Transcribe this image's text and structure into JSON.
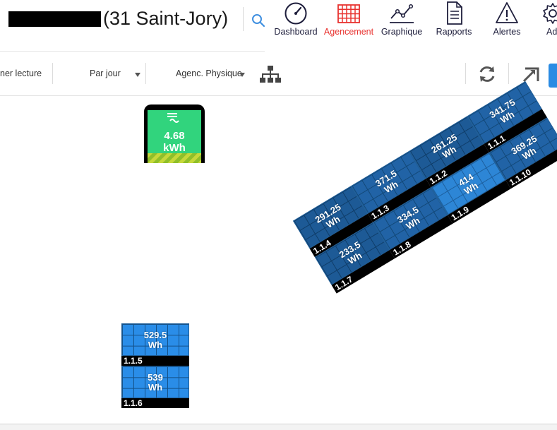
{
  "header": {
    "site_name": "(31 Saint-Jory)",
    "nav": [
      {
        "label": "Dashboard",
        "icon": "dashboard-gauge-icon",
        "active": false
      },
      {
        "label": "Agencement",
        "icon": "grid-icon",
        "active": true
      },
      {
        "label": "Graphique",
        "icon": "line-chart-icon",
        "active": false
      },
      {
        "label": "Rapports",
        "icon": "document-icon",
        "active": false
      },
      {
        "label": "Alertes",
        "icon": "warning-icon",
        "active": false
      },
      {
        "label": "Ad",
        "icon": "gear-icon",
        "active": false
      }
    ],
    "active_color": "#e8322f"
  },
  "toolbar": {
    "reading_label": "ner lecture",
    "period_select": "Par jour",
    "layout_select": "Agenc. Physique",
    "accent_color": "#2a8be3"
  },
  "meter": {
    "value": "4.68",
    "unit": "kWh"
  },
  "panels_rotated": [
    {
      "id": "1.1.4",
      "value": "291.25",
      "unit": "Wh"
    },
    {
      "id": "1.1.3",
      "value": "371.5",
      "unit": "Wh"
    },
    {
      "id": "1.1.2",
      "value": "261.25",
      "unit": "Wh"
    },
    {
      "id": "1.1.1",
      "value": "341.75",
      "unit": "Wh"
    },
    {
      "id": "1.1.7",
      "value": "233.5",
      "unit": "Wh"
    },
    {
      "id": "1.1.8",
      "value": "334.5",
      "unit": "Wh"
    },
    {
      "id": "1.1.9",
      "value": "414",
      "unit": "Wh"
    },
    {
      "id": "1.1.10",
      "value": "369.25",
      "unit": "Wh"
    }
  ],
  "panels_upright": [
    {
      "id": "1.1.5",
      "value": "529.5",
      "unit": "Wh"
    },
    {
      "id": "1.1.6",
      "value": "539",
      "unit": "Wh"
    }
  ]
}
